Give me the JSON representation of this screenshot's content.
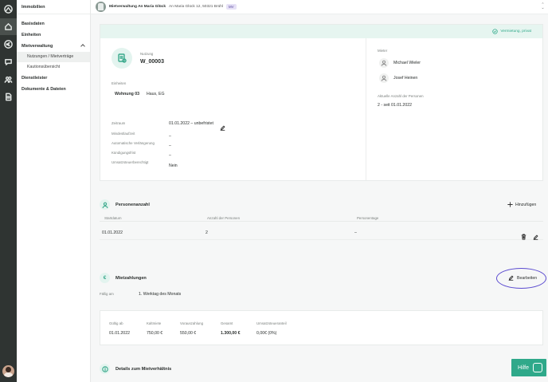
{
  "sidebar": {
    "header": "Immobilien",
    "items": [
      {
        "label": "Basisdaten"
      },
      {
        "label": "Einheiten"
      },
      {
        "label": "Mietverwaltung"
      },
      {
        "label": "Dienstleister"
      },
      {
        "label": "Dokumente & Dateien"
      }
    ],
    "subitems": [
      {
        "label": "Nutzungen / Mietverträge",
        "selected": true
      },
      {
        "label": "Kautionsübersicht",
        "selected": false
      }
    ]
  },
  "rail_icons": [
    "home-icon",
    "euro-icon",
    "chat-icon",
    "people-icon",
    "document-icon"
  ],
  "topbar": {
    "title": "Mietverwaltung An Maria Glück",
    "address": "An Maria Glück 12, 50321 Brühl",
    "badge": "MV"
  },
  "status": {
    "text": "Vermietung, privat",
    "color": "#2fa98a"
  },
  "nutzung": {
    "label": "Nutzung",
    "id": "W_00003",
    "units_label": "Einheiten",
    "unit_name": "Wohnung 03",
    "unit_location": "Haus, EG",
    "fields": [
      {
        "label": "Zeitraum",
        "value": "01.01.2022 – unbefristet"
      },
      {
        "label": "Mindestlaufzeit",
        "value": "–"
      },
      {
        "label": "Automatische Verlängerung",
        "value": "–"
      },
      {
        "label": "Kündigungsfrist",
        "value": "–"
      },
      {
        "label": "Umsatzsteuerberechtigt",
        "value": "Nein"
      }
    ]
  },
  "mieter": {
    "label": "Mieter",
    "names": [
      "Michael Wieler",
      "Josef Heinen"
    ],
    "count_label": "Aktuelle Anzahl der Personen",
    "count_value": "2 - seit 01.01.2022"
  },
  "personen": {
    "title": "Personenanzahl",
    "add_label": "Hinzufügen",
    "columns": [
      "Startdatum",
      "Anzahl der Personen",
      "Personentage"
    ],
    "rows": [
      {
        "start": "01.01.2022",
        "anzahl": "2",
        "tage": "–"
      }
    ]
  },
  "mietzahlungen": {
    "title": "Mietzahlungen",
    "edit_label": "Bearbeiten",
    "due_label": "Fällig am",
    "due_value": "1. Werktag des Monats",
    "columns": [
      "Gültig ab",
      "Kaltmiete",
      "Vorauszahlung",
      "Gesamt",
      "Umsatzsteueranteil"
    ],
    "values": [
      "01.01.2022",
      "750,00 €",
      "550,00 €",
      "1.300,00 €",
      "0,00€ (0%)"
    ]
  },
  "details": {
    "title": "Details zum Mietverhältnis"
  },
  "help": {
    "label": "Hilfe"
  }
}
